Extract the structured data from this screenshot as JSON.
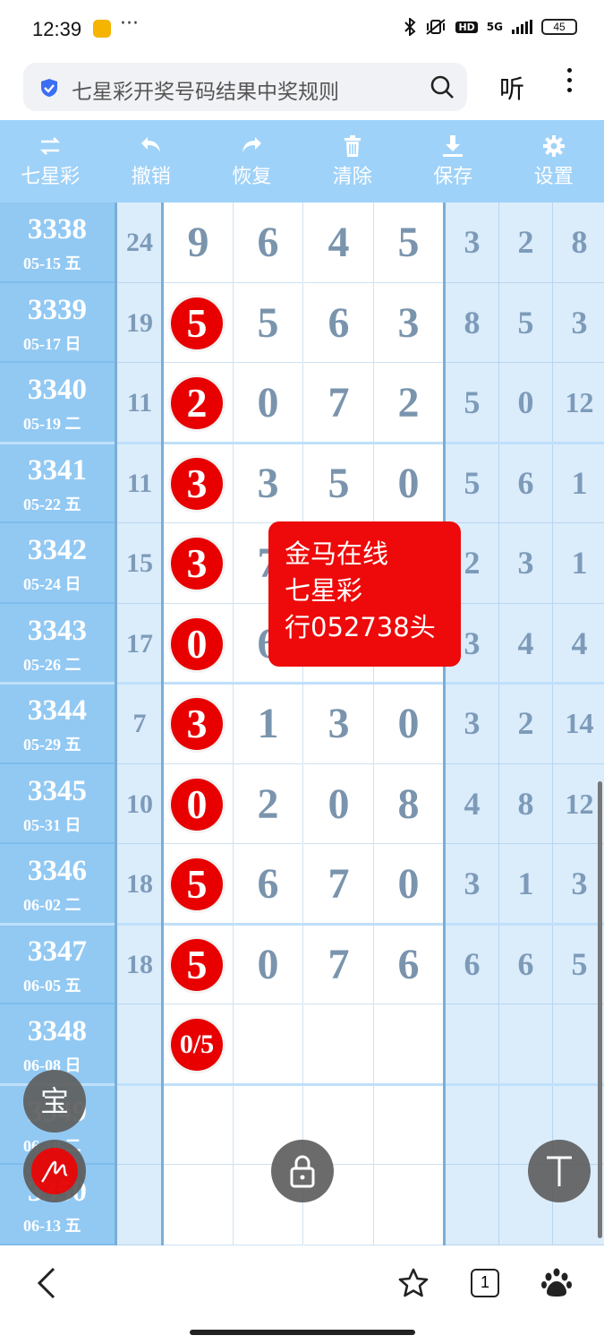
{
  "status_bar": {
    "time": "12:39",
    "more": "···",
    "network": "5G",
    "hd": "HD",
    "battery": "45"
  },
  "search": {
    "query": "七星彩开奖号码结果中奖规则",
    "listen_label": "听"
  },
  "toolbar": [
    {
      "label": "七星彩",
      "icon": "swap-icon"
    },
    {
      "label": "撤销",
      "icon": "undo-icon"
    },
    {
      "label": "恢复",
      "icon": "redo-icon"
    },
    {
      "label": "清除",
      "icon": "trash-icon"
    },
    {
      "label": "保存",
      "icon": "download-icon"
    },
    {
      "label": "设置",
      "icon": "gear-icon"
    }
  ],
  "rows": [
    {
      "issue": "3338",
      "date": "05-15 五",
      "sum": "24",
      "first": "9",
      "first_ball": false,
      "mid": [
        "6",
        "4",
        "5"
      ],
      "tail": [
        "3",
        "2",
        "8"
      ]
    },
    {
      "issue": "3339",
      "date": "05-17 日",
      "sum": "19",
      "first": "5",
      "first_ball": true,
      "mid": [
        "5",
        "6",
        "3"
      ],
      "tail": [
        "8",
        "5",
        "3"
      ]
    },
    {
      "issue": "3340",
      "date": "05-19 二",
      "sum": "11",
      "first": "2",
      "first_ball": true,
      "mid": [
        "0",
        "7",
        "2"
      ],
      "tail": [
        "5",
        "0",
        "12"
      ]
    },
    {
      "issue": "3341",
      "date": "05-22 五",
      "sum": "11",
      "first": "3",
      "first_ball": true,
      "mid": [
        "3",
        "5",
        "0"
      ],
      "tail": [
        "5",
        "6",
        "1"
      ]
    },
    {
      "issue": "3342",
      "date": "05-24 日",
      "sum": "15",
      "first": "3",
      "first_ball": true,
      "mid": [
        "7",
        "",
        ""
      ],
      "tail": [
        "2",
        "3",
        "1"
      ]
    },
    {
      "issue": "3343",
      "date": "05-26 二",
      "sum": "17",
      "first": "0",
      "first_ball": true,
      "mid": [
        "6",
        "",
        ""
      ],
      "tail": [
        "3",
        "4",
        "4"
      ]
    },
    {
      "issue": "3344",
      "date": "05-29 五",
      "sum": "7",
      "first": "3",
      "first_ball": true,
      "mid": [
        "1",
        "3",
        "0"
      ],
      "tail": [
        "3",
        "2",
        "14"
      ]
    },
    {
      "issue": "3345",
      "date": "05-31 日",
      "sum": "10",
      "first": "0",
      "first_ball": true,
      "mid": [
        "2",
        "0",
        "8"
      ],
      "tail": [
        "4",
        "8",
        "12"
      ]
    },
    {
      "issue": "3346",
      "date": "06-02 二",
      "sum": "18",
      "first": "5",
      "first_ball": true,
      "mid": [
        "6",
        "7",
        "0"
      ],
      "tail": [
        "3",
        "1",
        "3"
      ]
    },
    {
      "issue": "3347",
      "date": "06-05 五",
      "sum": "18",
      "first": "5",
      "first_ball": true,
      "mid": [
        "0",
        "7",
        "6"
      ],
      "tail": [
        "6",
        "6",
        "5"
      ]
    },
    {
      "issue": "3348",
      "date": "06-08 日",
      "sum": "",
      "first": "0/5",
      "first_ball": true,
      "mid": [
        "",
        "",
        ""
      ],
      "tail": [
        "",
        "",
        ""
      ]
    },
    {
      "issue": "3349",
      "date": "06-10 二",
      "sum": "",
      "first": "",
      "first_ball": false,
      "mid": [
        "",
        "",
        ""
      ],
      "tail": [
        "",
        "",
        ""
      ]
    },
    {
      "issue": "3350",
      "date": "06-13 五",
      "sum": "",
      "first": "",
      "first_ball": false,
      "mid": [
        "",
        "",
        ""
      ],
      "tail": [
        "",
        "",
        ""
      ]
    }
  ],
  "popup": {
    "line1": "金马在线",
    "line2": "七星彩",
    "line3": "行052738头"
  },
  "floating": {
    "bao_label": "宝"
  },
  "bottom_nav": {
    "tabs_count": "1"
  },
  "colors": {
    "toolbar_bg": "#9fd2f8",
    "issue_bg": "#92c9f3",
    "ball_red": "#e80000",
    "popup_red": "#ee0a0a"
  }
}
